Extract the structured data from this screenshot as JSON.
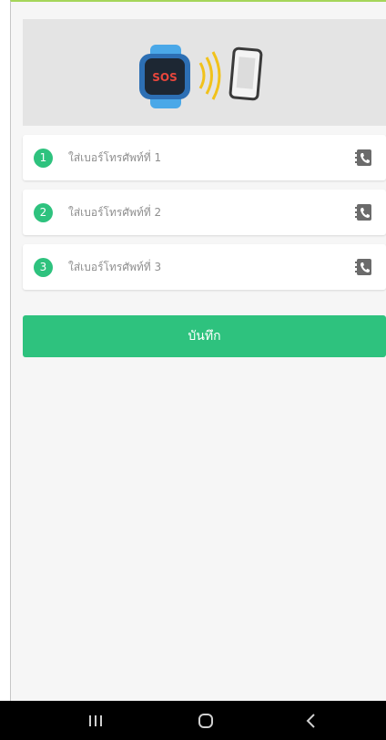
{
  "banner": {
    "watch_label": "SOS"
  },
  "phone_fields": [
    {
      "index": "1",
      "placeholder": "ใส่เบอร์โทรศัพท์ที่ 1",
      "value": ""
    },
    {
      "index": "2",
      "placeholder": "ใส่เบอร์โทรศัพท์ที่ 2",
      "value": ""
    },
    {
      "index": "3",
      "placeholder": "ใส่เบอร์โทรศัพท์ที่ 3",
      "value": ""
    }
  ],
  "save_label": "บันทึก",
  "colors": {
    "accent": "#2ec27e",
    "banner_bg": "#e4e4e4",
    "page_bg": "#f6f6f6",
    "top_line": "#a5d65a"
  },
  "icons": {
    "contact": "contact-book-icon",
    "recents": "recent-apps-icon",
    "home": "home-icon",
    "back": "back-icon"
  }
}
